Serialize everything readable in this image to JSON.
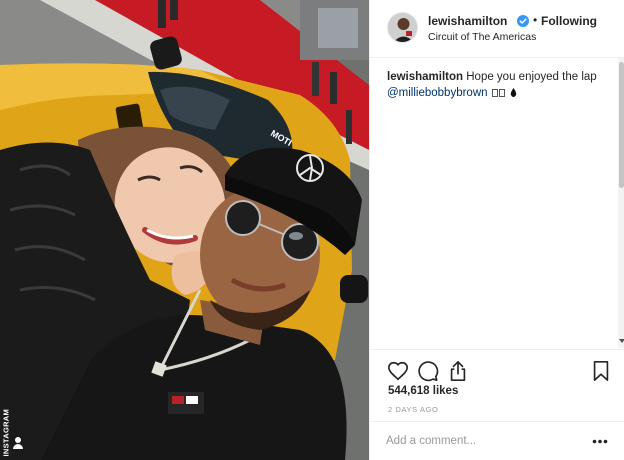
{
  "post": {
    "username": "lewishamilton",
    "separator": "•",
    "follow_status": "Following",
    "location": "Circuit of The Americas",
    "caption": {
      "username": "lewishamilton",
      "text": "Hope you enjoyed the lap",
      "mention": "@milliebobbybrown"
    },
    "likes": "544,618 likes",
    "timestamp": "2 DAYS AGO"
  },
  "comment_box": {
    "placeholder": "Add a comment..."
  },
  "watermark": {
    "text": "INSTAGRAM"
  },
  "icons": {
    "verified": "verified-badge-icon",
    "like": "heart-icon",
    "comment": "comment-bubble-icon",
    "share": "share-icon",
    "save": "bookmark-icon",
    "more": "more-options-icon"
  },
  "colors": {
    "verified_blue": "#3897f0",
    "mention": "#003569",
    "muted": "#999999",
    "text": "#262626"
  }
}
